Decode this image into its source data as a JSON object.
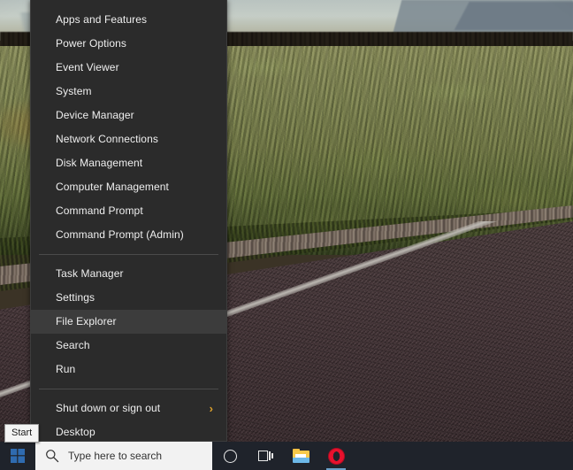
{
  "menu": {
    "groups": [
      {
        "items": [
          {
            "label": "Apps and Features",
            "selected": false,
            "submenu": false
          },
          {
            "label": "Power Options",
            "selected": false,
            "submenu": false
          },
          {
            "label": "Event Viewer",
            "selected": false,
            "submenu": false
          },
          {
            "label": "System",
            "selected": false,
            "submenu": false
          },
          {
            "label": "Device Manager",
            "selected": false,
            "submenu": false
          },
          {
            "label": "Network Connections",
            "selected": false,
            "submenu": false
          },
          {
            "label": "Disk Management",
            "selected": false,
            "submenu": false
          },
          {
            "label": "Computer Management",
            "selected": false,
            "submenu": false
          },
          {
            "label": "Command Prompt",
            "selected": false,
            "submenu": false
          },
          {
            "label": "Command Prompt (Admin)",
            "selected": false,
            "submenu": false
          }
        ]
      },
      {
        "items": [
          {
            "label": "Task Manager",
            "selected": false,
            "submenu": false
          },
          {
            "label": "Settings",
            "selected": false,
            "submenu": false
          },
          {
            "label": "File Explorer",
            "selected": true,
            "submenu": false
          },
          {
            "label": "Search",
            "selected": false,
            "submenu": false
          },
          {
            "label": "Run",
            "selected": false,
            "submenu": false
          }
        ]
      },
      {
        "items": [
          {
            "label": "Shut down or sign out",
            "selected": false,
            "submenu": true,
            "submenu_glyph": "›"
          },
          {
            "label": "Desktop",
            "selected": false,
            "submenu": false
          }
        ]
      }
    ],
    "colors": {
      "background": "#2b2b2b",
      "selected_background": "#3c3c3c",
      "text": "#efefef",
      "separator": "#4a4a4a",
      "submenu_chevron": "#dda12c"
    }
  },
  "tooltip": {
    "text": "Start"
  },
  "taskbar": {
    "start_button": {
      "name": "Start",
      "icon": "windows-logo-icon",
      "color": "#2f6bb0"
    },
    "search": {
      "placeholder": "Type here to search",
      "icon": "search-icon",
      "background": "#f2f2f2"
    },
    "buttons": [
      {
        "name": "Cortana",
        "icon": "cortana-circle-icon",
        "active": false
      },
      {
        "name": "Task View",
        "icon": "task-view-icon",
        "active": false
      },
      {
        "name": "File Explorer",
        "icon": "folder-icon",
        "active": false
      },
      {
        "name": "Opera",
        "icon": "opera-icon",
        "active": true
      }
    ],
    "background": "#1f232b"
  },
  "desktop": {
    "wallpaper_description": "Sagebrush plain with distant treeline, mountains and a paved road with white edge line"
  }
}
